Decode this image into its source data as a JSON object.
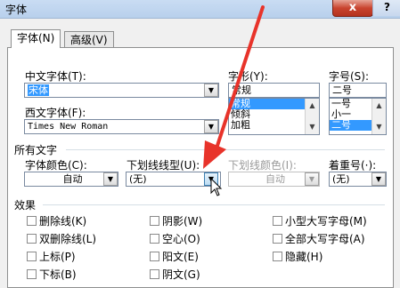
{
  "window": {
    "title": "字体",
    "help": "?",
    "close": "x"
  },
  "tabs": [
    {
      "label": "字体(N)"
    },
    {
      "label": "高级(V)"
    }
  ],
  "fonts": {
    "chinese_font_label": "中文字体(T):",
    "chinese_font_value": "宋体",
    "western_font_label": "西文字体(F):",
    "western_font_value": "Times New Roman",
    "style_label": "字形(Y):",
    "style_value": "常规",
    "style_options": [
      "常规",
      "倾斜",
      "加粗"
    ],
    "size_label": "字号(S):",
    "size_value": "二号",
    "size_options": [
      "一号",
      "小一",
      "二号"
    ]
  },
  "all_text": {
    "section_label": "所有文字",
    "font_color_label": "字体颜色(C):",
    "font_color_value": "自动",
    "underline_type_label": "下划线线型(U):",
    "underline_type_value": "(无)",
    "underline_color_label": "下划线颜色(I):",
    "underline_color_value": "自动",
    "emphasis_label": "着重号(·):",
    "emphasis_value": "(无)"
  },
  "effects": {
    "section_label": "效果",
    "col1": [
      "删除线(K)",
      "双删除线(L)",
      "上标(P)",
      "下标(B)"
    ],
    "col2": [
      "阴影(W)",
      "空心(O)",
      "阳文(E)",
      "阴文(G)"
    ],
    "col3": [
      "小型大写字母(M)",
      "全部大写字母(A)",
      "隐藏(H)"
    ]
  },
  "icons": {
    "dropdown": "▼",
    "scroll_up": "▲",
    "scroll_down": "▼"
  },
  "colors": {
    "selection": "#3399ff",
    "annotation_arrow": "#e8332a"
  }
}
